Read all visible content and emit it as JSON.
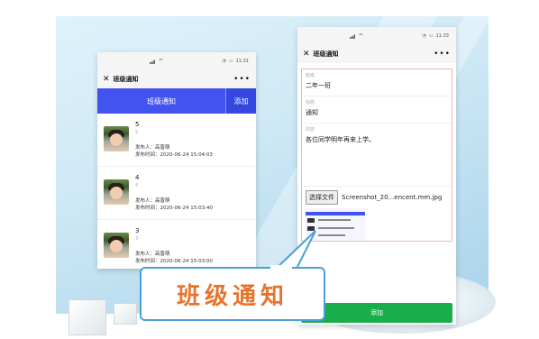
{
  "left_phone": {
    "status_signal": "⁴ᴳ",
    "status_time": "11:31",
    "window_title": "班级通知",
    "header_title": "班级通知",
    "add_label": "添加",
    "items": [
      {
        "number": "5",
        "sub": "5",
        "author": "发布人：高晋萌",
        "time": "发布时间：2020-06-24 15:04:03"
      },
      {
        "number": "4",
        "sub": "4",
        "author": "发布人：高晋萌",
        "time": "发布时间：2020-06-24 15:03:40"
      },
      {
        "number": "3",
        "sub": "3",
        "author": "发布人：高晋萌",
        "time": "发布时间：2020-06-24 15:03:00"
      }
    ]
  },
  "right_phone": {
    "status_signal": "⁴ᴳ",
    "status_time": "11:33",
    "window_title": "班级通知",
    "fields": {
      "class_label": "班级",
      "class_value": "二年一班",
      "title_label": "标题",
      "title_value": "通知",
      "content_label": "内容",
      "content_value": "各位同学明年再来上学。"
    },
    "file_button": "选择文件",
    "file_name": "Screenshot_20...encent.mm.jpg",
    "submit_label": "添加"
  },
  "callout_text": "班级通知",
  "colors": {
    "header_blue": "#4353f0",
    "submit_green": "#1aad4b",
    "callout_orange": "#e8742c",
    "callout_border": "#4b9fd8"
  }
}
